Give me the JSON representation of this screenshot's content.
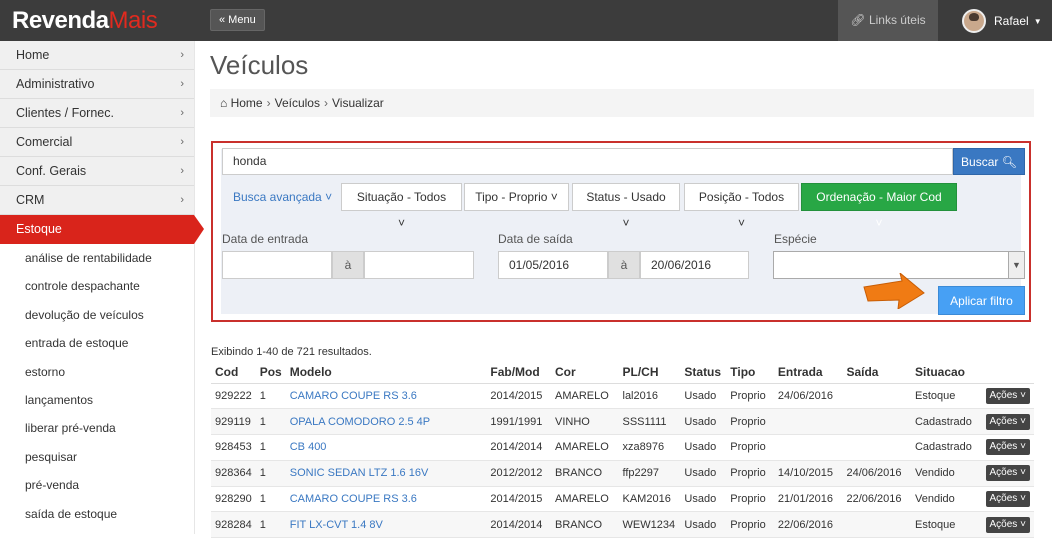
{
  "header": {
    "logo_part1": "Revenda",
    "logo_part2": "Mais",
    "menu_label": "« Menu",
    "links_label": "Links úteis",
    "user_name": "Rafael"
  },
  "sidebar": {
    "items": [
      {
        "label": "Home"
      },
      {
        "label": "Administrativo"
      },
      {
        "label": "Clientes / Fornec."
      },
      {
        "label": "Comercial"
      },
      {
        "label": "Conf. Gerais"
      },
      {
        "label": "CRM"
      },
      {
        "label": "Estoque"
      }
    ],
    "subitems": [
      "análise de rentabilidade",
      "controle despachante",
      "devolução de veículos",
      "entrada de estoque",
      "estorno",
      "lançamentos",
      "liberar pré-venda",
      "pesquisar",
      "pré-venda",
      "saída de estoque"
    ]
  },
  "page": {
    "title": "Veículos",
    "breadcrumb": [
      "Home",
      "Veículos",
      "Visualizar"
    ]
  },
  "filter": {
    "search_value": "honda",
    "search_button": "Buscar",
    "advanced": "Busca avançada",
    "dropdowns": {
      "situacao": "Situação - Todos",
      "tipo": "Tipo - Proprio",
      "status": "Status - Usado",
      "posicao": "Posição - Todos",
      "ordenacao": "Ordenação - Maior Cod"
    },
    "entrada_label": "Data de entrada",
    "entrada_from": "",
    "entrada_to": "",
    "saida_label": "Data de saída",
    "saida_from": "01/05/2016",
    "saida_to": "20/06/2016",
    "range_sep": "à",
    "especie_label": "Espécie",
    "especie_value": "",
    "apply_button": "Aplicar filtro"
  },
  "results_text": "Exibindo 1-40 de 721 resultados.",
  "table": {
    "headers": {
      "cod": "Cod",
      "pos": "Pos",
      "modelo": "Modelo",
      "fabmod": "Fab/Mod",
      "cor": "Cor",
      "plch": "PL/CH",
      "status": "Status",
      "tipo": "Tipo",
      "entrada": "Entrada",
      "saida": "Saída",
      "situacao": "Situacao"
    },
    "action_label": "Ações",
    "rows": [
      {
        "cod": "929222",
        "pos": "1",
        "modelo": "CAMARO COUPE RS 3.6",
        "fabmod": "2014/2015",
        "cor": "AMARELO",
        "plch": "lal2016",
        "status": "Usado",
        "tipo": "Proprio",
        "entrada": "24/06/2016",
        "saida": "",
        "situacao": "Estoque"
      },
      {
        "cod": "929119",
        "pos": "1",
        "modelo": "OPALA COMODORO 2.5 4P",
        "fabmod": "1991/1991",
        "cor": "VINHO",
        "plch": "SSS1111",
        "status": "Usado",
        "tipo": "Proprio",
        "entrada": "",
        "saida": "",
        "situacao": "Cadastrado"
      },
      {
        "cod": "928453",
        "pos": "1",
        "modelo": "CB 400",
        "fabmod": "2014/2014",
        "cor": "AMARELO",
        "plch": "xza8976",
        "status": "Usado",
        "tipo": "Proprio",
        "entrada": "",
        "saida": "",
        "situacao": "Cadastrado"
      },
      {
        "cod": "928364",
        "pos": "1",
        "modelo": "SONIC SEDAN LTZ 1.6 16V",
        "fabmod": "2012/2012",
        "cor": "BRANCO",
        "plch": "ffp2297",
        "status": "Usado",
        "tipo": "Proprio",
        "entrada": "14/10/2015",
        "saida": "24/06/2016",
        "situacao": "Vendido"
      },
      {
        "cod": "928290",
        "pos": "1",
        "modelo": "CAMARO COUPE RS 3.6",
        "fabmod": "2014/2015",
        "cor": "AMARELO",
        "plch": "KAM2016",
        "status": "Usado",
        "tipo": "Proprio",
        "entrada": "21/01/2016",
        "saida": "22/06/2016",
        "situacao": "Vendido"
      },
      {
        "cod": "928284",
        "pos": "1",
        "modelo": "FIT LX-CVT 1.4 8V",
        "fabmod": "2014/2014",
        "cor": "BRANCO",
        "plch": "WEW1234",
        "status": "Usado",
        "tipo": "Proprio",
        "entrada": "22/06/2016",
        "saida": "",
        "situacao": "Estoque"
      }
    ]
  },
  "colors": {
    "brand_red": "#d9241b",
    "link_blue": "#3a78c2",
    "green": "#28a745",
    "highlight_border": "#c9302c",
    "arrow_orange": "#f07b14"
  }
}
